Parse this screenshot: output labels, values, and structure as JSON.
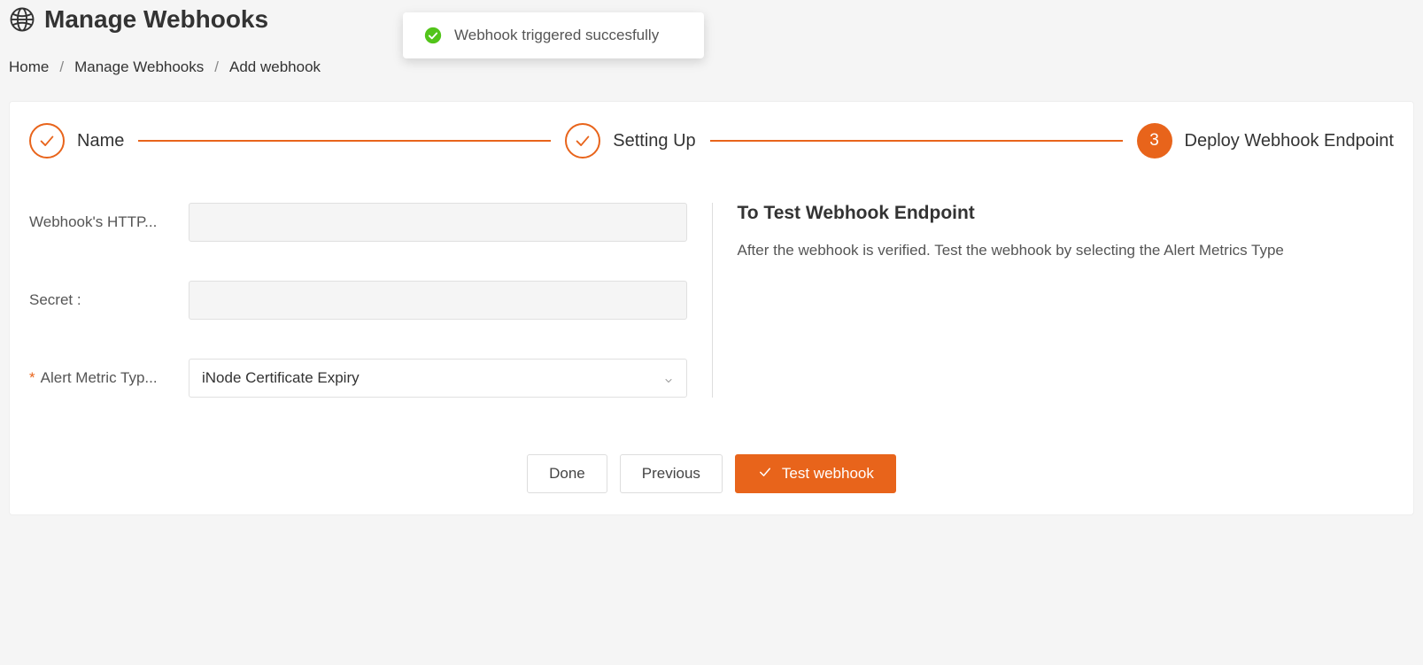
{
  "header": {
    "title": "Manage Webhooks"
  },
  "breadcrumb": {
    "home": "Home",
    "manage": "Manage Webhooks",
    "add": "Add webhook"
  },
  "toast": {
    "message": "Webhook triggered succesfully"
  },
  "steps": {
    "step1_label": "Name",
    "step2_label": "Setting Up",
    "step3_number": "3",
    "step3_label": "Deploy Webhook Endpoint"
  },
  "form": {
    "url_label": "Webhook's HTTP...",
    "url_value": "",
    "secret_label": "Secret :",
    "secret_value": "",
    "metric_label": "Alert Metric Typ...",
    "metric_value": "iNode Certificate Expiry"
  },
  "info": {
    "title": "To Test Webhook Endpoint",
    "body": "After the webhook is verified. Test the webhook by selecting the Alert Metrics Type"
  },
  "actions": {
    "done": "Done",
    "previous": "Previous",
    "test": "Test webhook"
  }
}
